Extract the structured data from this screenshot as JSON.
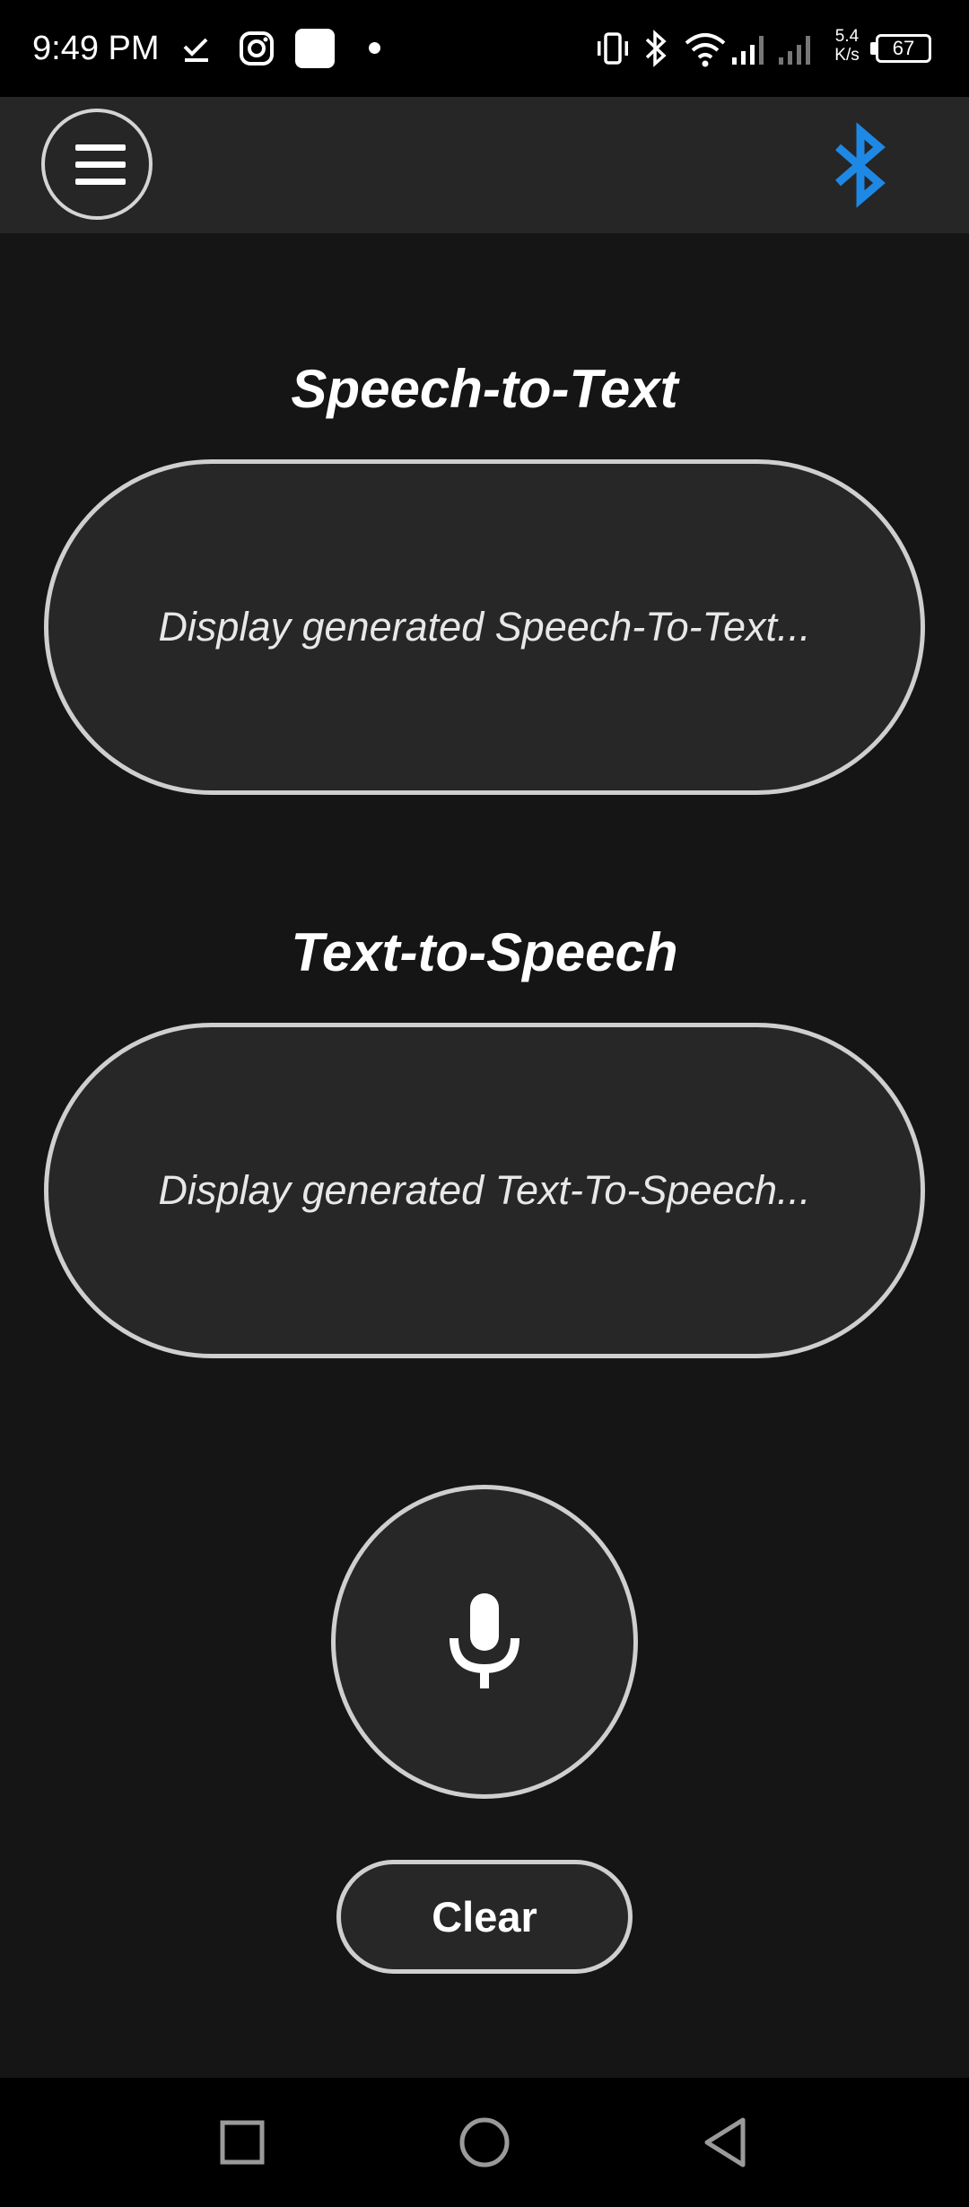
{
  "status_bar": {
    "time": "9:49 PM",
    "net_speed_value": "5.4",
    "net_speed_unit": "K/s",
    "battery_level": "67",
    "icons": [
      "check-download-icon",
      "instagram-icon",
      "app-square-icon",
      "notification-dot-icon",
      "vibrate-icon",
      "bluetooth-status-icon",
      "wifi-icon",
      "signal-icon",
      "signal-2-icon",
      "battery-icon"
    ]
  },
  "app_bar": {
    "menu_icon": "hamburger-menu-icon",
    "bluetooth_icon": "bluetooth-icon",
    "bluetooth_color": "#1e88e5"
  },
  "speech_to_text": {
    "title": "Speech-to-Text",
    "placeholder": "Display generated Speech-To-Text..."
  },
  "text_to_speech": {
    "title": "Text-to-Speech",
    "placeholder": "Display generated Text-To-Speech..."
  },
  "controls": {
    "mic_icon": "microphone-icon",
    "clear_label": "Clear"
  },
  "nav_bar": {
    "recents_icon": "square-recents-icon",
    "home_icon": "circle-home-icon",
    "back_icon": "triangle-back-icon"
  },
  "colors": {
    "background": "#151515",
    "app_bar": "#262626",
    "surface": "#272727",
    "outline": "#cfcfcf",
    "accent": "#1e88e5"
  }
}
